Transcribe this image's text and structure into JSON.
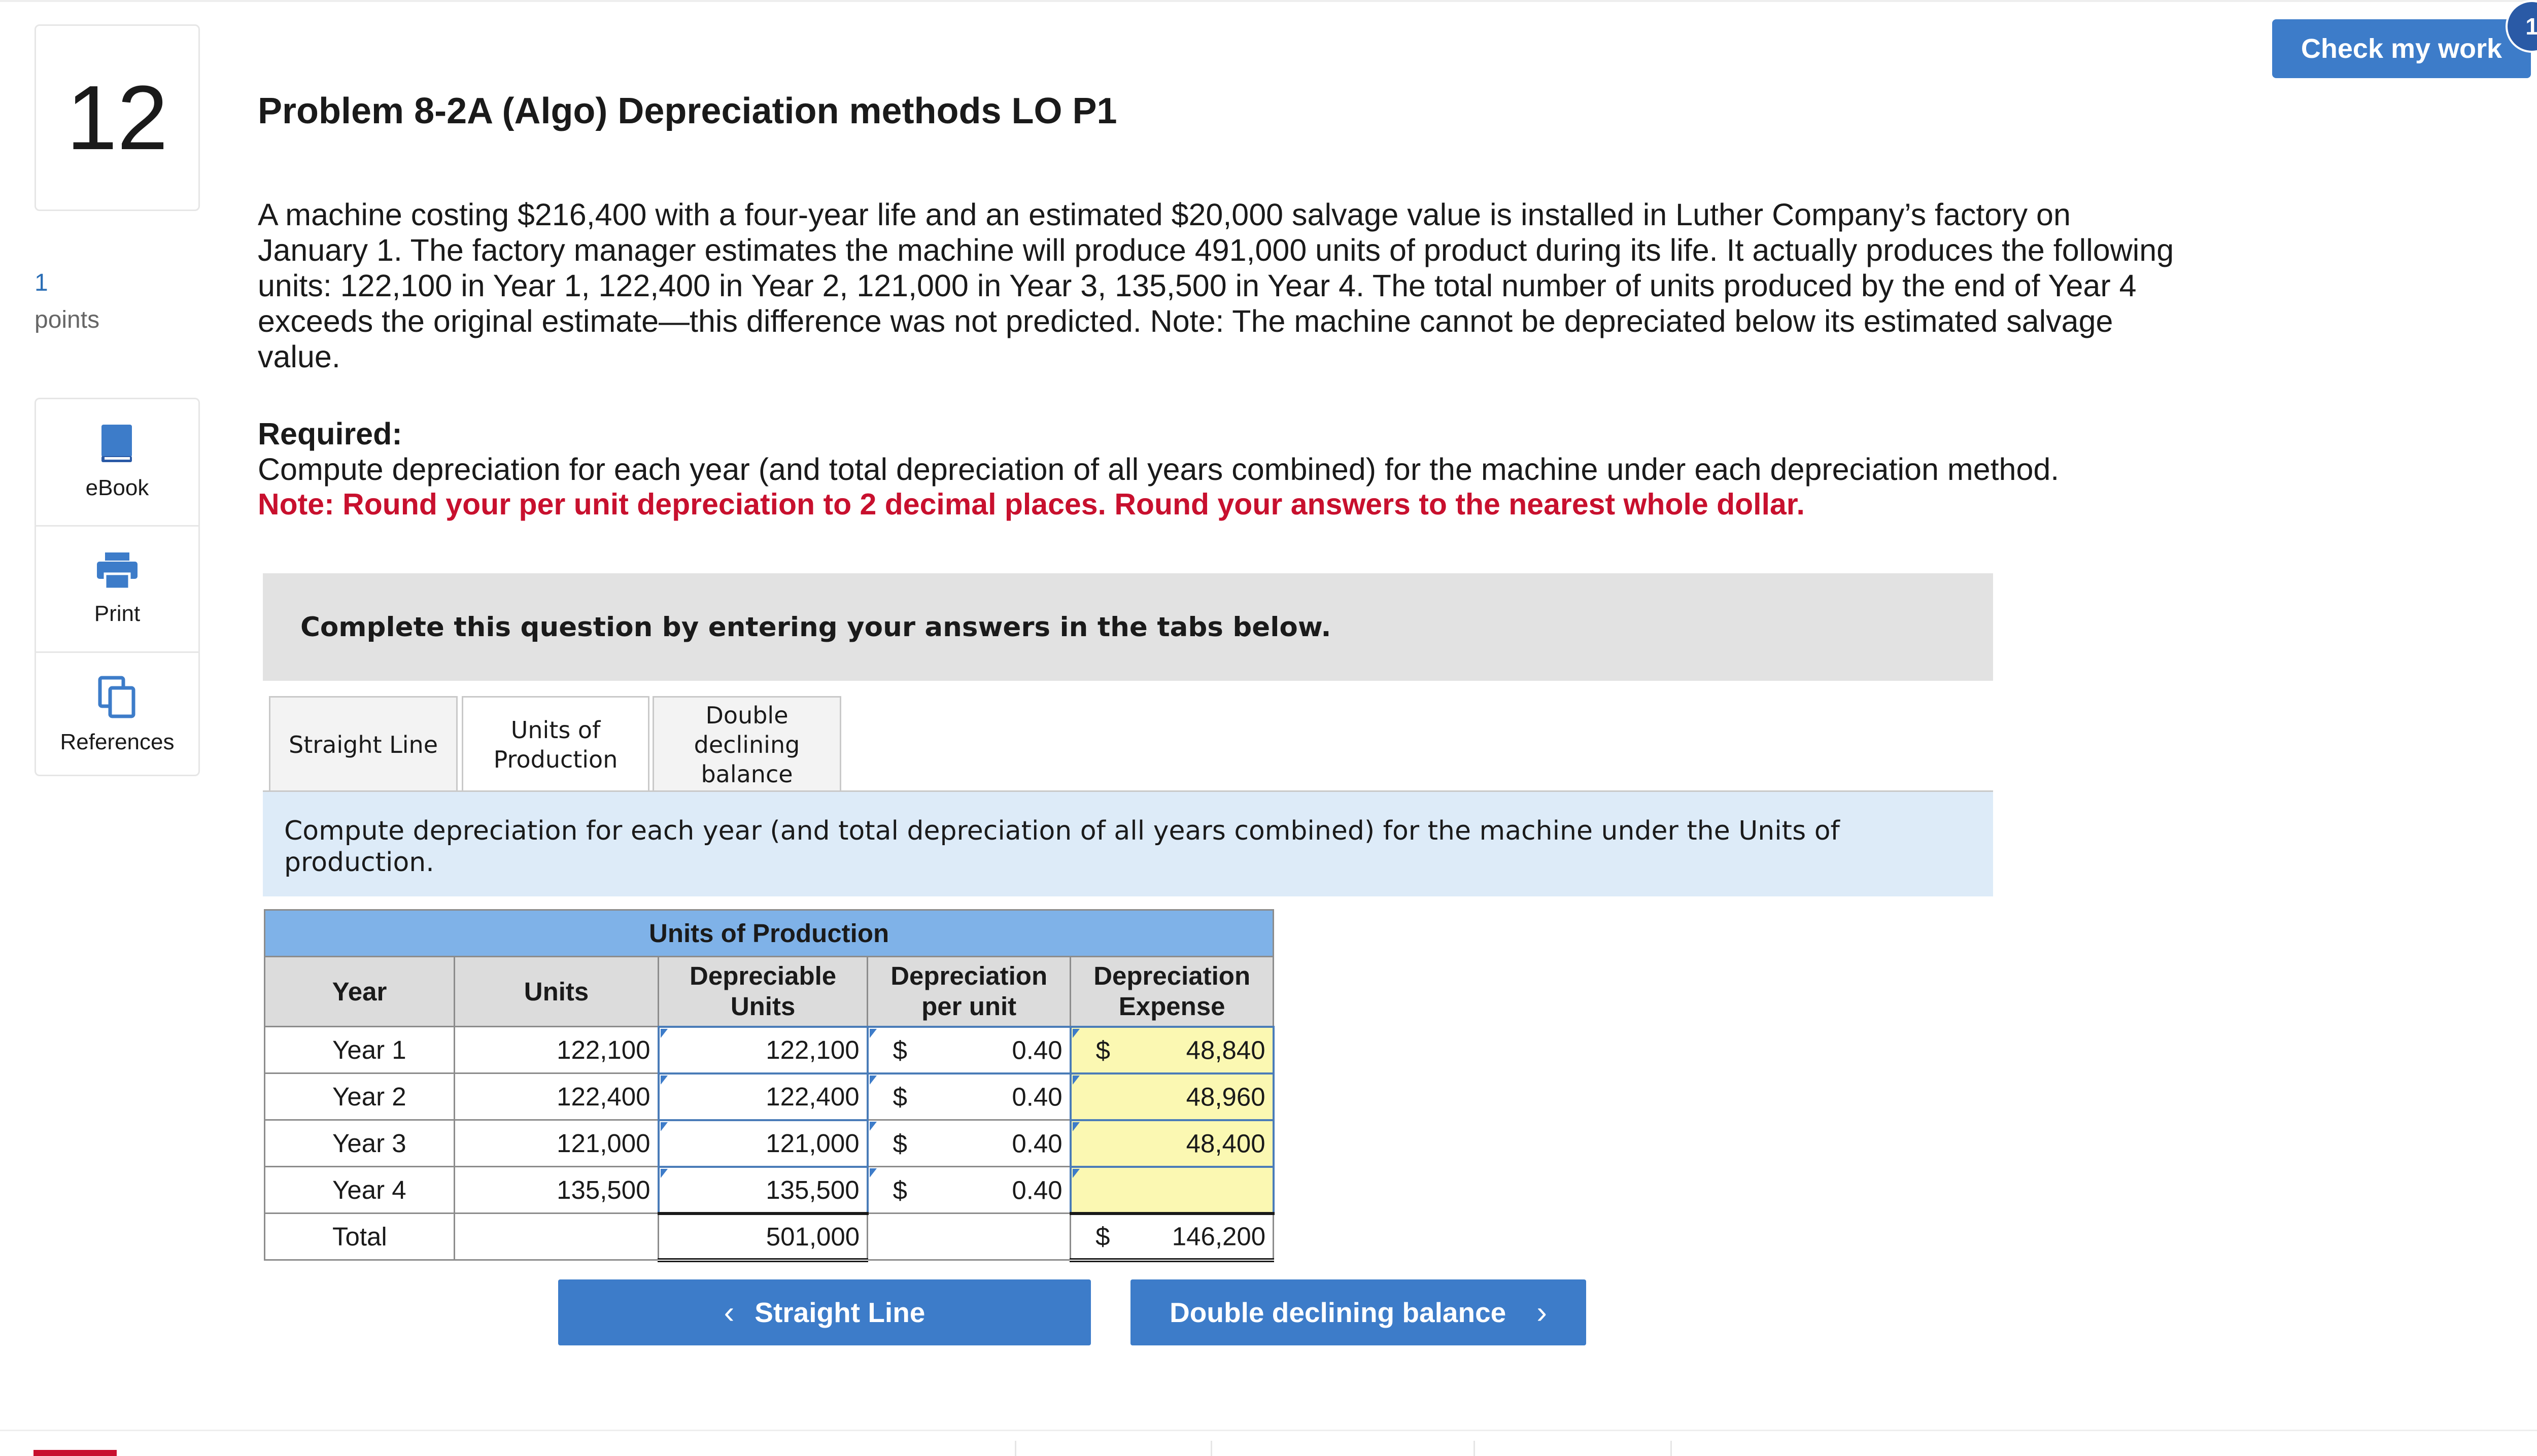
{
  "question": {
    "number": "12",
    "points_value": "1",
    "points_label": "points"
  },
  "tools": [
    {
      "label": "eBook",
      "icon": "book-icon"
    },
    {
      "label": "Print",
      "icon": "printer-icon"
    },
    {
      "label": "References",
      "icon": "copy-pages-icon"
    }
  ],
  "check": {
    "label": "Check my work",
    "badge": "1"
  },
  "problem": {
    "title": "Problem 8-2A (Algo) Depreciation methods LO P1",
    "text": "A machine costing $216,400 with a four-year life and an estimated $20,000 salvage value is installed in Luther Company’s factory on January 1. The factory manager estimates the machine will produce 491,000 units of product during its life. It actually produces the following units: 122,100 in Year 1, 122,400 in Year 2, 121,000 in Year 3, 135,500 in Year 4. The total number of units produced by the end of Year 4 exceeds the original estimate—this difference was not predicted. Note: The machine cannot be depreciated below its estimated salvage value.",
    "required_heading": "Required:",
    "required_text": "Compute depreciation for each year (and total depreciation of all years combined) for the machine under each depreciation method.",
    "note": "Note: Round your per unit depreciation to 2 decimal places. Round your answers to the nearest whole dollar."
  },
  "instructions": "Complete this question by entering your answers in the tabs below.",
  "tabs": [
    {
      "label": "Straight Line",
      "active": false
    },
    {
      "label": "Units of Production",
      "active": true
    },
    {
      "label": "Double declining balance",
      "active": false
    }
  ],
  "panel_description": "Compute depreciation for each year (and total depreciation of all years combined) for the machine under the Units of production.",
  "table": {
    "caption": "Units of Production",
    "headers": [
      "Year",
      "Units",
      "Depreciable Units",
      "Depreciation per unit",
      "Depreciation Expense"
    ],
    "rows": [
      {
        "year": "Year 1",
        "units": "122,100",
        "dep_units": "122,100",
        "per_unit_sym": "$",
        "per_unit": "0.40",
        "exp_sym": "$",
        "expense": "48,840"
      },
      {
        "year": "Year 2",
        "units": "122,400",
        "dep_units": "122,400",
        "per_unit_sym": "$",
        "per_unit": "0.40",
        "exp_sym": "",
        "expense": "48,960"
      },
      {
        "year": "Year 3",
        "units": "121,000",
        "dep_units": "121,000",
        "per_unit_sym": "$",
        "per_unit": "0.40",
        "exp_sym": "",
        "expense": "48,400"
      },
      {
        "year": "Year 4",
        "units": "135,500",
        "dep_units": "135,500",
        "per_unit_sym": "$",
        "per_unit": "0.40",
        "exp_sym": "",
        "expense": ""
      }
    ],
    "total": {
      "label": "Total",
      "dep_units": "501,000",
      "exp_sym": "$",
      "expense": "146,200"
    }
  },
  "nav": {
    "prev_label": "Straight Line",
    "next_label": "Double declining balance"
  }
}
